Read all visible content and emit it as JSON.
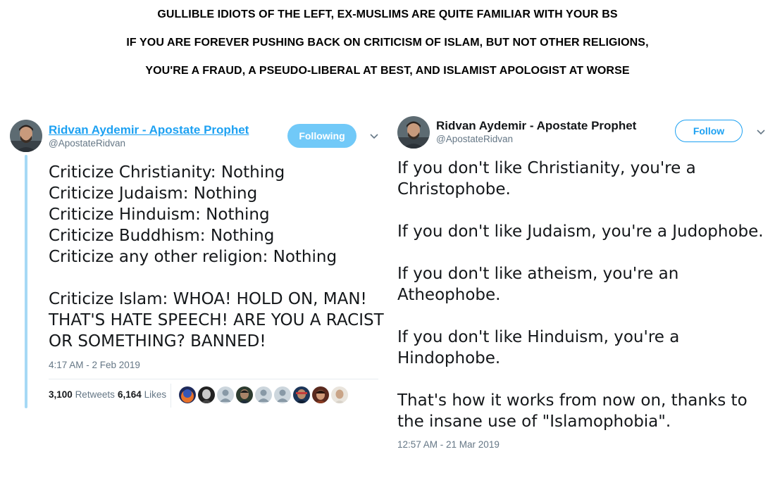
{
  "header": {
    "line1": "GULLIBLE IDIOTS OF THE LEFT, EX-MUSLIMS ARE QUITE FAMILIAR WITH YOUR BS",
    "line2": "IF YOU ARE FOREVER PUSHING BACK ON CRITICISM OF ISLAM, BUT NOT OTHER RELIGIONS,",
    "line3": "YOU'RE A FRAUD, A PSEUDO-LIBERAL AT BEST, AND ISLAMIST APOLOGIST AT WORSE"
  },
  "tweet_left": {
    "author_name": "Ridvan Aydemir - Apostate Prophet",
    "author_handle": "@ApostateRidvan",
    "follow_button": "Following",
    "text": "Criticize Christianity: Nothing\nCriticize Judaism: Nothing\nCriticize Hinduism: Nothing\nCriticize Buddhism: Nothing\nCriticize any other religion: Nothing\n\nCriticize Islam: WHOA! HOLD ON, MAN! THAT'S HATE SPEECH! ARE YOU A RACIST OR SOMETHING? BANNED!",
    "timestamp": "4:17 AM - 2 Feb 2019",
    "retweets_count": "3,100",
    "retweets_label": "Retweets",
    "likes_count": "6,164",
    "likes_label": "Likes",
    "liker_avatars": [
      "photo",
      "photo",
      "default",
      "photo",
      "default",
      "default",
      "photo",
      "photo",
      "photo"
    ]
  },
  "tweet_right": {
    "author_name": "Ridvan Aydemir - Apostate Prophet",
    "author_handle": "@ApostateRidvan",
    "follow_button": "Follow",
    "text": "If you don't like Christianity, you're a Christophobe.\n\nIf you don't like Judaism, you're a Judophobe.\n\nIf you don't like atheism, you're an Atheophobe.\n\nIf you don't like Hinduism, you're a Hindophobe.\n\nThat's how it works from now on, thanks to the insane use of \"Islamophobia\".",
    "timestamp": "12:57 AM - 21 Mar 2019"
  },
  "colors": {
    "link_blue": "#1da1f2",
    "following_bg": "#71c9f8",
    "thread_line": "#a6d9f5",
    "secondary_text": "#657786"
  }
}
